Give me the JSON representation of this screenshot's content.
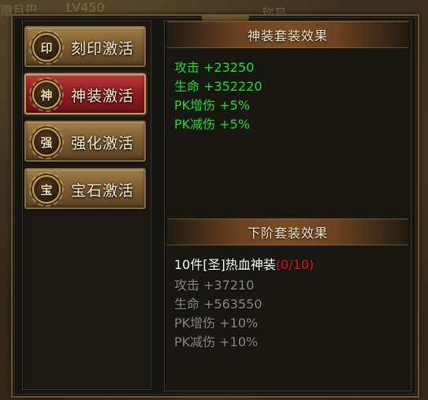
{
  "background": {
    "top_left_text": "赠月巴",
    "level_text": "LV450",
    "top_middle_text": "称号"
  },
  "tabs": [
    {
      "label": "刻印激活",
      "icon_char": "印",
      "icon": "seal-emblem-icon",
      "active": false
    },
    {
      "label": "神装激活",
      "icon_char": "神",
      "icon": "divine-emblem-icon",
      "active": true
    },
    {
      "label": "强化激活",
      "icon_char": "强",
      "icon": "enhance-emblem-icon",
      "active": false
    },
    {
      "label": "宝石激活",
      "icon_char": "宝",
      "icon": "gem-emblem-icon",
      "active": false
    }
  ],
  "current_set": {
    "header": "神装套装效果",
    "stats": [
      "攻击 +23250",
      "生命 +352220",
      "PK增伤 +5%",
      "PK减伤 +5%"
    ]
  },
  "next_set": {
    "header": "下阶套装效果",
    "title": "10件[圣]热血神装",
    "progress": "(0/10)",
    "stats": [
      "攻击 +37210",
      "生命 +563550",
      "PK增伤 +10%",
      "PK减伤 +10%"
    ]
  },
  "colors": {
    "active_stat": "#1ee61e",
    "inactive_stat": "#8c8a84",
    "progress": "#e01818",
    "active_tab": "#8e1f22",
    "tab": "#7c5e32"
  }
}
